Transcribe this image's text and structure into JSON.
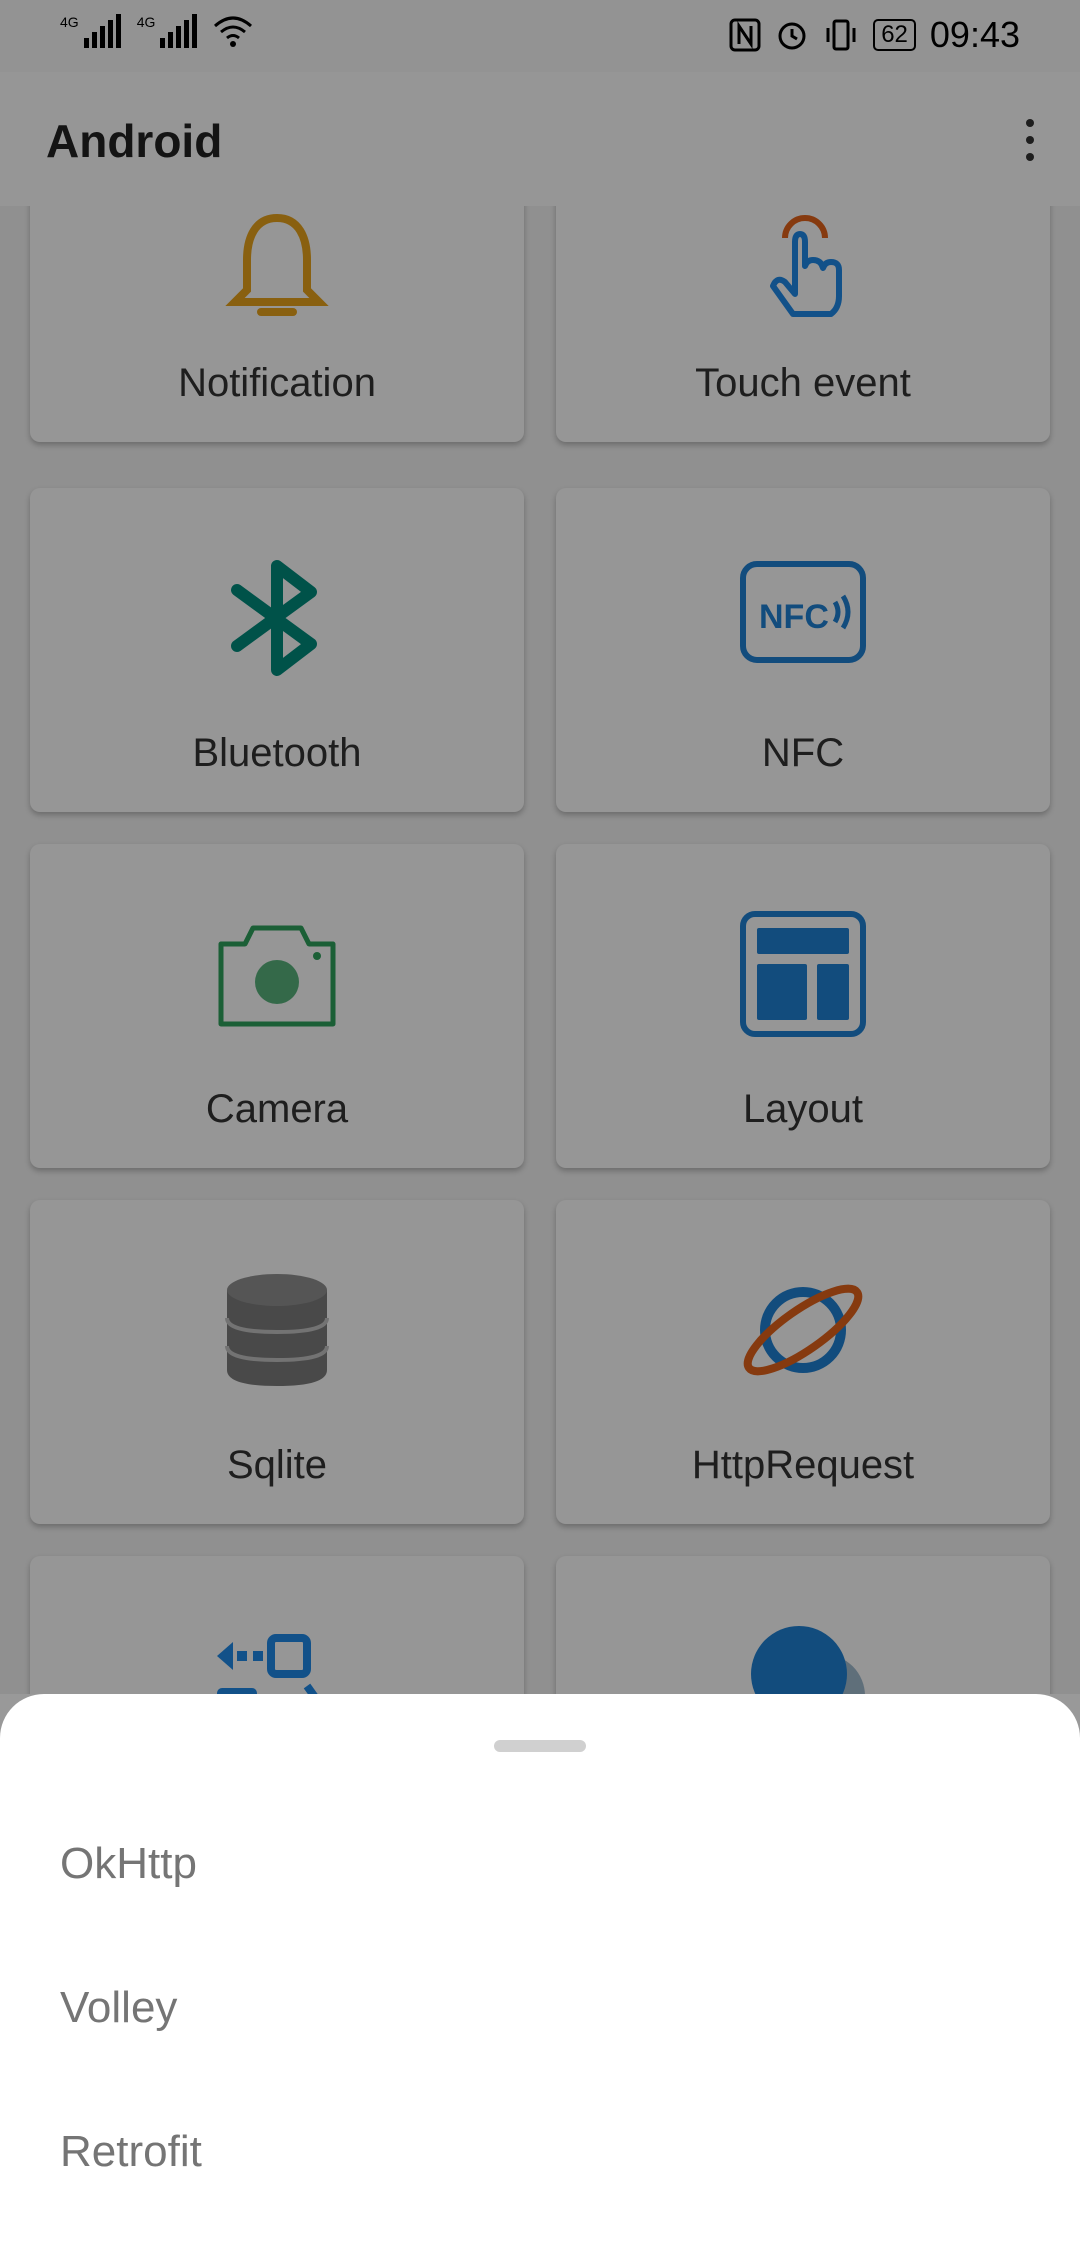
{
  "status_bar": {
    "signal1": "4G",
    "signal2": "4G",
    "battery": "62",
    "time": "09:43"
  },
  "app_bar": {
    "title": "Android"
  },
  "grid": {
    "items": [
      {
        "label": "Notification",
        "icon": "bell-icon",
        "color": "#E4A11B"
      },
      {
        "label": "Touch event",
        "icon": "touch-hand-icon",
        "color": "#1E88E5"
      },
      {
        "label": "Bluetooth",
        "icon": "bluetooth-icon",
        "color": "#00897B"
      },
      {
        "label": "NFC",
        "icon": "nfc-icon",
        "color": "#1E7FD0"
      },
      {
        "label": "Camera",
        "icon": "camera-icon",
        "color": "#2E9E5B"
      },
      {
        "label": "Layout",
        "icon": "layout-icon",
        "color": "#1E7FD0"
      },
      {
        "label": "Sqlite",
        "icon": "database-icon",
        "color": "#9E9E9E"
      },
      {
        "label": "HttpRequest",
        "icon": "planet-icon",
        "color": "#E0611A"
      }
    ]
  },
  "sheet": {
    "options": [
      "OkHttp",
      "Volley",
      "Retrofit"
    ]
  }
}
